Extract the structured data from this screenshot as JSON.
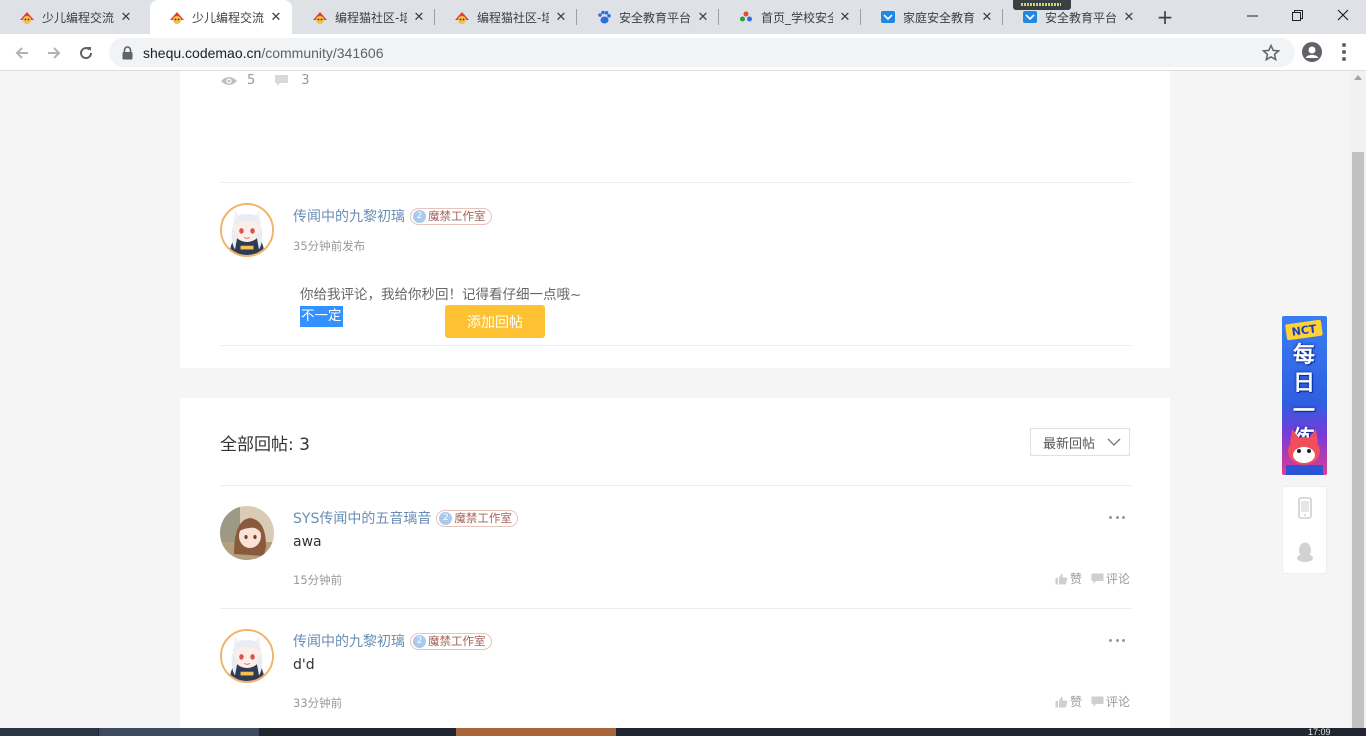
{
  "browser": {
    "tabs": [
      {
        "title": "少儿编程交流_",
        "icon": "codemao-favicon",
        "active": false
      },
      {
        "title": "少儿编程交流_",
        "icon": "codemao-favicon",
        "active": true
      },
      {
        "title": "编程猫社区-培",
        "icon": "codemao-favicon",
        "active": false
      },
      {
        "title": "编程猫社区-培",
        "icon": "codemao-favicon",
        "active": false
      },
      {
        "title": "安全教育平台_",
        "icon": "baidu-paw-favicon",
        "active": false
      },
      {
        "title": "首页_学校安全",
        "icon": "school-favicon",
        "active": false
      },
      {
        "title": "家庭安全教育",
        "icon": "safety-platform-favicon",
        "active": false
      },
      {
        "title": "安全教育平台_",
        "icon": "safety-platform-favicon",
        "active": false
      }
    ],
    "url_host": "shequ.codemao.cn",
    "url_path": "/community/341606"
  },
  "post": {
    "views": "5",
    "comments": "3",
    "author": "传闻中的九黎初璃",
    "badge_level": "2",
    "badge_text": "魔禁工作室",
    "time": "35分钟前发布",
    "body_line1": "你给我评论，我给你秒回！记得看仔细一点哦~",
    "body_line2": "不一定",
    "add_reply_label": "添加回帖"
  },
  "replies": {
    "title": "全部回帖: 3",
    "sort_label": "最新回帖",
    "items": [
      {
        "author": "SYS传闻中的五音璃音",
        "badge_level": "2",
        "badge_text": "魔禁工作室",
        "text": "awa",
        "time": "15分钟前",
        "like": "赞",
        "comment": "评论"
      },
      {
        "author": "传闻中的九黎初璃",
        "badge_level": "2",
        "badge_text": "魔禁工作室",
        "text": "d'd",
        "time": "33分钟前",
        "like": "赞",
        "comment": "评论"
      }
    ]
  },
  "side": {
    "promo_tag": "NCT",
    "promo_text": "每日一练"
  },
  "taskbar": {
    "clock": "17:09"
  },
  "colors": {
    "accent_button": "#fdc132",
    "author_link": "#6a8db4",
    "selection": "#3390ff"
  }
}
